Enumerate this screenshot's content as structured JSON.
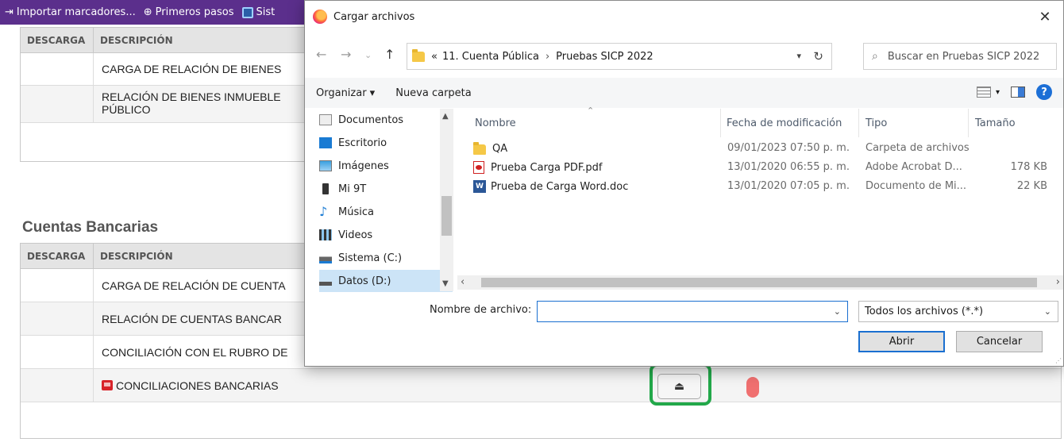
{
  "bookmarks_bar": {
    "items": [
      {
        "icon": "import-icon",
        "label": "Importar marcadores..."
      },
      {
        "icon": "globe-icon",
        "label": "Primeros pasos"
      },
      {
        "icon": "app-icon",
        "label": "Sist"
      }
    ]
  },
  "background_page": {
    "table1": {
      "col_descarga": "DESCARGA",
      "col_descripcion": "DESCRIPCIÓN",
      "rows": [
        "CARGA DE RELACIÓN DE BIENES",
        "RELACIÓN DE BIENES INMUEBLE\nPÚBLICO"
      ]
    },
    "section_title": "Cuentas Bancarias",
    "table2": {
      "col_descarga": "DESCARGA",
      "col_descripcion": "DESCRIPCIÓN",
      "rows": [
        "CARGA DE RELACIÓN DE CUENTA",
        "RELACIÓN DE CUENTAS BANCAR",
        "CONCILIACIÓN CON EL RUBRO DE",
        "CONCILIACIONES BANCARIAS"
      ]
    },
    "upload_icon": "upload-icon",
    "status_color": "#f07070",
    "highlight_color": "#22a84a"
  },
  "dialog": {
    "title": "Cargar archivos",
    "close_glyph": "✕",
    "breadcrumb": {
      "prefix": "«",
      "parts": [
        "11. Cuenta Pública",
        "Pruebas SICP 2022"
      ],
      "separator": "›"
    },
    "search_placeholder": "Buscar en Pruebas SICP 2022",
    "toolbar": {
      "organize": "Organizar ▾",
      "new_folder": "Nueva carpeta"
    },
    "nav_items": [
      {
        "label": "Documentos",
        "icon": "documents-icon"
      },
      {
        "label": "Escritorio",
        "icon": "desktop-icon"
      },
      {
        "label": "Imágenes",
        "icon": "pictures-icon"
      },
      {
        "label": "Mi 9T",
        "icon": "phone-icon"
      },
      {
        "label": "Música",
        "icon": "music-icon"
      },
      {
        "label": "Videos",
        "icon": "videos-icon"
      },
      {
        "label": "Sistema (C:)",
        "icon": "system-drive-icon"
      },
      {
        "label": "Datos (D:)",
        "icon": "drive-icon",
        "selected": true
      }
    ],
    "columns": {
      "name": "Nombre",
      "date": "Fecha de modificación",
      "type": "Tipo",
      "size": "Tamaño"
    },
    "files": [
      {
        "name": "QA",
        "date": "09/01/2023 07:50 p. m.",
        "type": "Carpeta de archivos",
        "size": "",
        "icon": "folder-icon"
      },
      {
        "name": "Prueba Carga PDF.pdf",
        "date": "13/01/2020 06:55 p. m.",
        "type": "Adobe Acrobat D...",
        "size": "178 KB",
        "icon": "pdf-icon"
      },
      {
        "name": "Prueba de Carga Word.doc",
        "date": "13/01/2020 07:05 p. m.",
        "type": "Documento de Mi...",
        "size": "22 KB",
        "icon": "word-icon"
      }
    ],
    "filename_label": "Nombre de archivo:",
    "filename_value": "",
    "filter_value": "Todos los archivos (*.*)",
    "open_button": "Abrir",
    "cancel_button": "Cancelar"
  }
}
